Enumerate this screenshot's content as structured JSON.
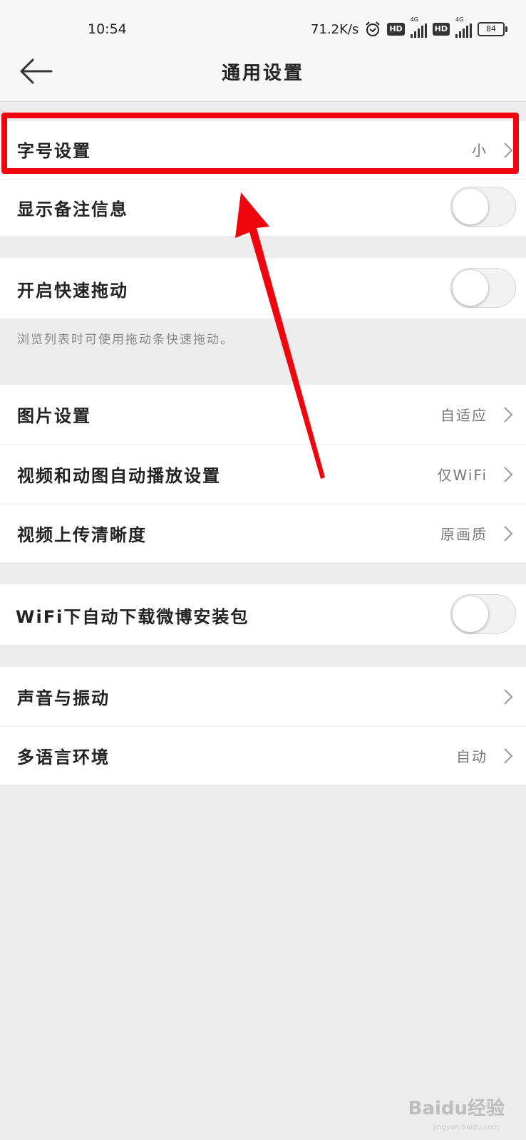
{
  "status_bar": {
    "time": "10:54",
    "speed": "71.2K/s",
    "hd1": "HD",
    "net1": "4G",
    "hd2": "HD",
    "net2": "4G",
    "battery": "84"
  },
  "header": {
    "title": "通用设置"
  },
  "rows": {
    "font_size": {
      "label": "字号设置",
      "value": "小"
    },
    "show_remarks": {
      "label": "显示备注信息",
      "enabled": false
    },
    "fast_drag": {
      "label": "开启快速拖动",
      "enabled": false,
      "hint": "浏览列表时可使用拖动条快速拖动。"
    },
    "image_settings": {
      "label": "图片设置",
      "value": "自适应"
    },
    "autoplay": {
      "label": "视频和动图自动播放设置",
      "value": "仅WiFi"
    },
    "upload_quality": {
      "label": "视频上传清晰度",
      "value": "原画质"
    },
    "wifi_download": {
      "label": "WiFi下自动下载微博安装包",
      "enabled": false
    },
    "sound_vibration": {
      "label": "声音与振动"
    },
    "language": {
      "label": "多语言环境",
      "value": "自动"
    }
  },
  "watermark": {
    "brand": "Baidu经验",
    "url": "jingyan.baidu.com"
  },
  "colors": {
    "annotation_red": "#f0050f",
    "background": "#ececec"
  }
}
